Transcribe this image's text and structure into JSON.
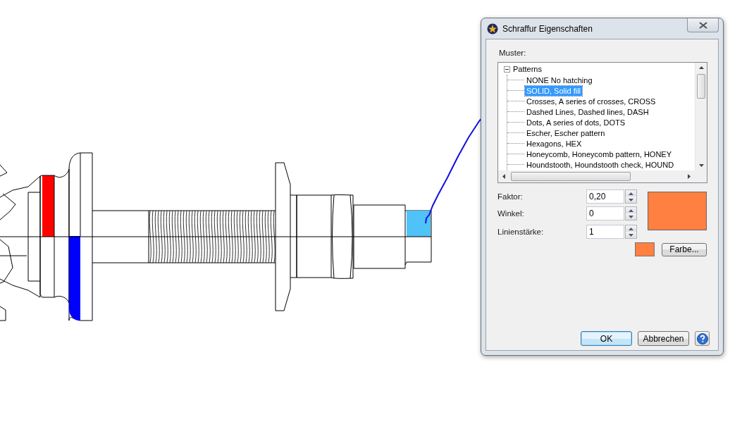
{
  "dialog": {
    "title": "Schraffur Eigenschaften",
    "pattern_label": "Muster:",
    "tree": {
      "label": "Patterns",
      "expanded": true,
      "children": [
        {
          "label": "NONE No hatching",
          "selected": false
        },
        {
          "label": "SOLID, Solid fill",
          "selected": true
        },
        {
          "label": "Crosses, A series of crosses, CROSS",
          "selected": false
        },
        {
          "label": "Dashed Lines, Dashed lines, DASH",
          "selected": false
        },
        {
          "label": "Dots, A series of dots, DOTS",
          "selected": false
        },
        {
          "label": "Escher, Escher pattern",
          "selected": false
        },
        {
          "label": "Hexagons, HEX",
          "selected": false
        },
        {
          "label": "Honeycomb, Honeycomb pattern, HONEY",
          "selected": false
        },
        {
          "label": "Houndstooth, Houndstooth check, HOUND",
          "selected": false
        }
      ]
    },
    "fields": [
      {
        "label": "Faktor:",
        "value": "0,20"
      },
      {
        "label": "Winkel:",
        "value": "0"
      },
      {
        "label": "Linienstärke:",
        "value": "1"
      }
    ],
    "color": "#ff8040",
    "color_button": "Farbe...",
    "buttons": [
      {
        "label": "OK",
        "default": true
      },
      {
        "label": "Abbrechen",
        "default": false
      }
    ]
  }
}
